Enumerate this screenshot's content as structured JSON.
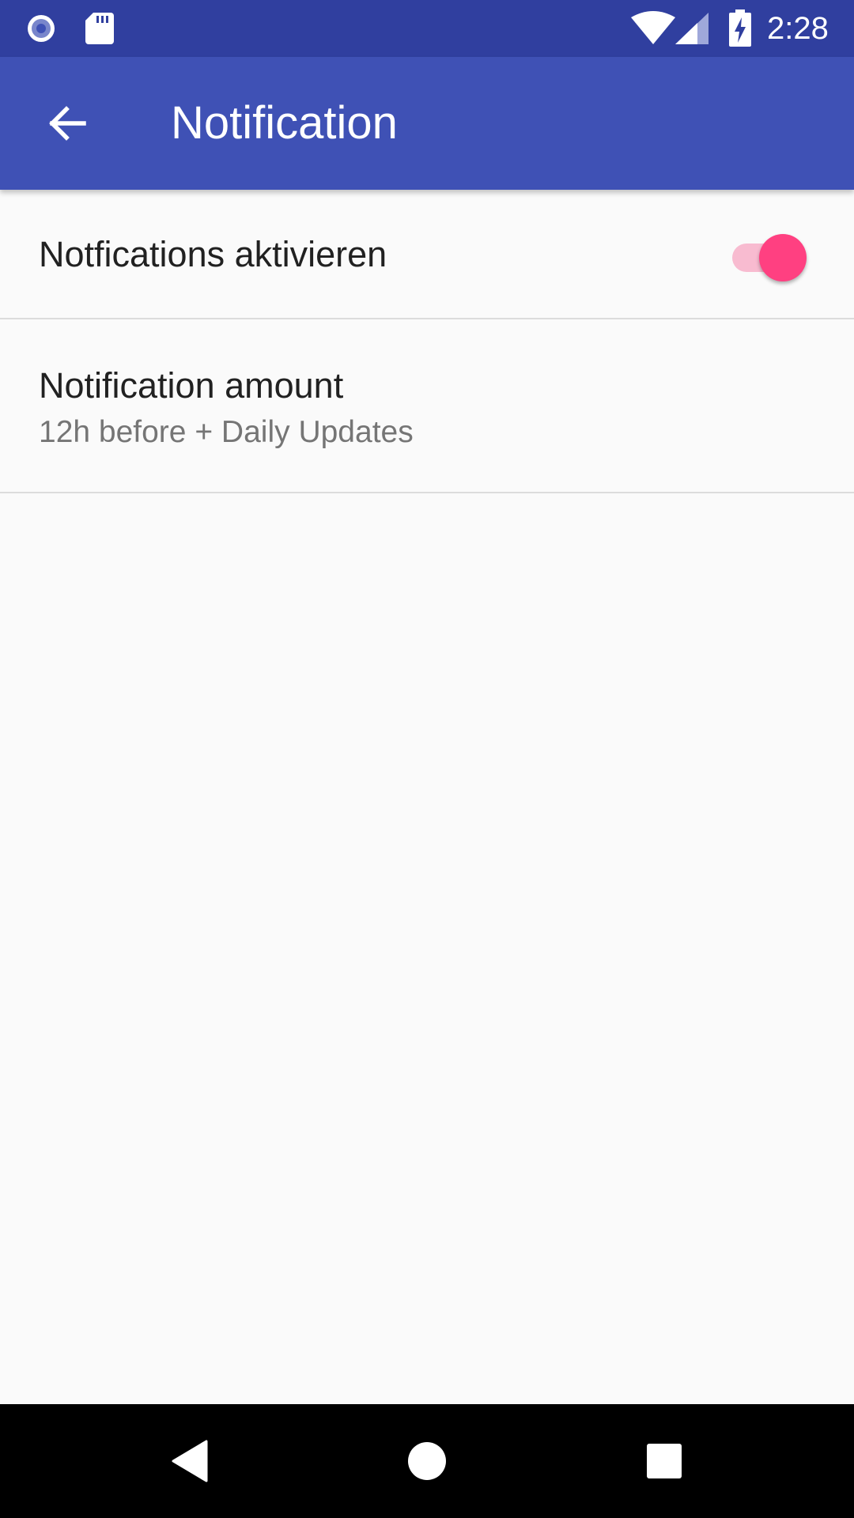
{
  "status_bar": {
    "time": "2:28",
    "icons": [
      "record-icon",
      "sd-card-icon",
      "wifi-icon",
      "signal-icon",
      "battery-charging-icon"
    ]
  },
  "app_bar": {
    "title": "Notification",
    "back_icon": "arrow-back-icon"
  },
  "preferences": [
    {
      "title": "Notfications aktivieren",
      "type": "switch",
      "checked": true
    },
    {
      "title": "Notification amount",
      "summary": "12h before + Daily Updates",
      "type": "list"
    }
  ],
  "nav_bar": {
    "icons": [
      "nav-back-icon",
      "nav-home-icon",
      "nav-recents-icon"
    ]
  },
  "colors": {
    "status_bar": "#303f9f",
    "app_bar": "#3f51b5",
    "accent": "#ff4081",
    "switch_track": "#f8bbd0",
    "background": "#fafafa",
    "primary_text": "#212121",
    "secondary_text": "#757575"
  }
}
